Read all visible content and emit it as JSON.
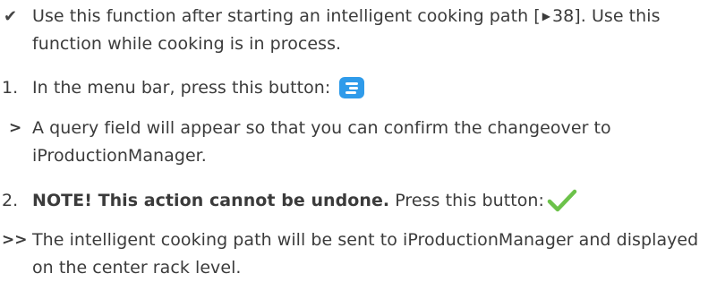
{
  "requirement": {
    "text_before_ref": "Use this function after starting an intelligent cooking path [",
    "ref_page": "38",
    "text_after_ref": "]. Use this function while cooking is in process."
  },
  "step1": {
    "number": "1.",
    "text": "In the menu bar, press this button:",
    "icon": "menu-list-icon",
    "icon_color": "#2f9bea"
  },
  "result1": {
    "marker": ">",
    "text": "A query field will appear so that you can confirm the changeover to iProductionManager."
  },
  "step2": {
    "number": "2.",
    "note": "NOTE! This action cannot be undone.",
    "text": "Press this button:",
    "icon": "confirm-check-icon",
    "icon_color": "#6cc24a"
  },
  "final_result": {
    "marker": ">>",
    "text": "The intelligent cooking path will be sent to iProductionManager and displayed on the center rack level."
  }
}
